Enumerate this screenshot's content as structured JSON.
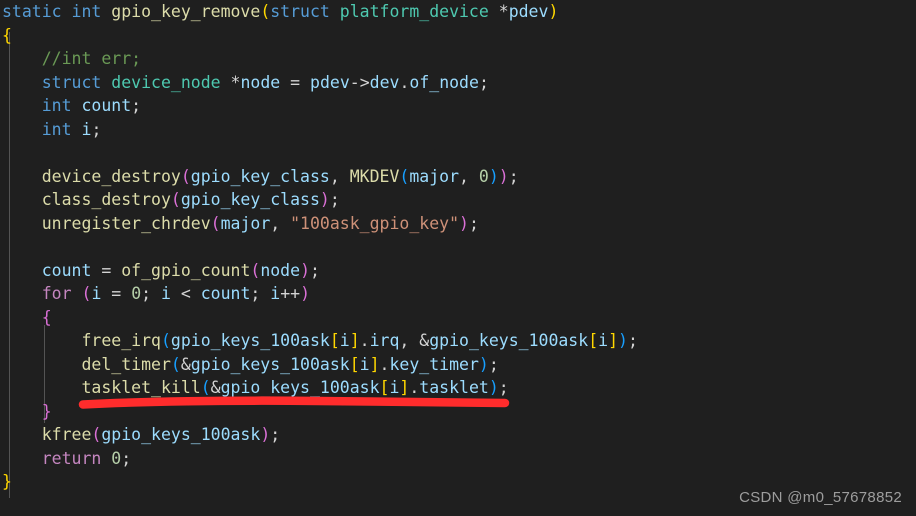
{
  "editor": {
    "background_color": "#1f1f1f",
    "language": "c",
    "colors": {
      "keyword": "#569cd6",
      "control": "#c586c0",
      "function": "#dcdcaa",
      "type": "#4ec9b0",
      "variable": "#9cdcfe",
      "string": "#ce9178",
      "comment": "#6a9955",
      "number": "#b5cea8",
      "operator": "#d4d4d4",
      "bracket_gold": "#ffd700",
      "bracket_orchid": "#da70d6",
      "bracket_blue": "#179fff",
      "indent_guide": "#545454",
      "annotation_red": "#ff2c2c",
      "watermark": "#b3b3b3"
    },
    "lines": [
      "static int gpio_key_remove(struct platform_device *pdev)",
      "{",
      "    //int err;",
      "    struct device_node *node = pdev->dev.of_node;",
      "    int count;",
      "    int i;",
      "",
      "    device_destroy(gpio_key_class, MKDEV(major, 0));",
      "    class_destroy(gpio_key_class);",
      "    unregister_chrdev(major, \"100ask_gpio_key\");",
      "",
      "    count = of_gpio_count(node);",
      "    for (i = 0; i < count; i++)",
      "    {",
      "        free_irq(gpio_keys_100ask[i].irq, &gpio_keys_100ask[i]);",
      "        del_timer(&gpio_keys_100ask[i].key_timer);",
      "        tasklet_kill(&gpio_keys_100ask[i].tasklet);",
      "    }",
      "    kfree(gpio_keys_100ask);",
      "    return 0;",
      "}"
    ]
  },
  "annotation": {
    "type": "hand-drawn-underline",
    "color": "#ff2c2c",
    "target_line_text": "tasklet_kill(&gpio_keys_100ask[i].tasklet);",
    "target_line_index": 16
  },
  "watermark": {
    "text": "CSDN @m0_57678852"
  }
}
